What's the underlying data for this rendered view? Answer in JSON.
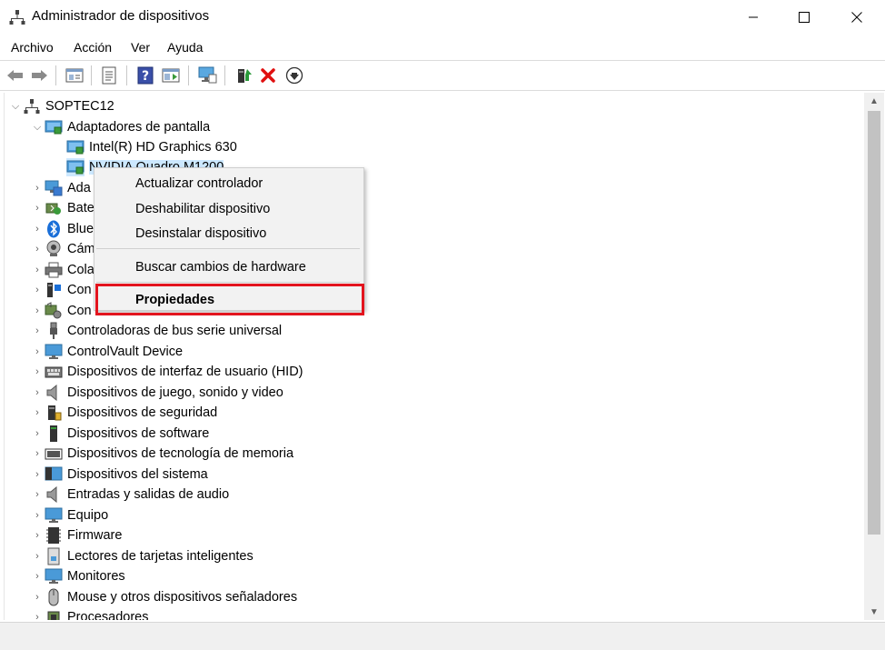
{
  "window": {
    "title": "Administrador de dispositivos",
    "controls": [
      "minimize",
      "maximize",
      "close"
    ]
  },
  "menu": [
    {
      "label": "Archivo"
    },
    {
      "label": "Acción"
    },
    {
      "label": "Ver"
    },
    {
      "label": "Ayuda"
    }
  ],
  "toolbar": [
    "back-icon",
    "forward-icon",
    "properties-view-icon",
    "properties-icon",
    "help-icon",
    "run-view-icon",
    "monitor-icon",
    "update-driver-icon",
    "uninstall-icon",
    "download-icon"
  ],
  "tree": {
    "root": "SOPTEC12",
    "expanded_category": "Adaptadores de pantalla",
    "children": [
      "Intel(R) HD Graphics 630",
      "NVIDIA Quadro M1200"
    ],
    "selected": "NVIDIA Quadro M1200",
    "partial_categories": [
      "Ada",
      "Bate",
      "Blue",
      "Cám",
      "Cola",
      "Con",
      "Con"
    ],
    "categories": [
      "Controladoras de bus serie universal",
      "ControlVault Device",
      "Dispositivos de interfaz de usuario (HID)",
      "Dispositivos de juego, sonido y video",
      "Dispositivos de seguridad",
      "Dispositivos de software",
      "Dispositivos de tecnología de memoria",
      "Dispositivos del sistema",
      "Entradas y salidas de audio",
      "Equipo",
      "Firmware",
      "Lectores de tarjetas inteligentes",
      "Monitores",
      "Mouse y otros dispositivos señaladores",
      "Procesadores"
    ]
  },
  "context_menu": {
    "items": [
      "Actualizar controlador",
      "Deshabilitar dispositivo",
      "Desinstalar dispositivo",
      "Buscar cambios de hardware",
      "Propiedades"
    ],
    "highlighted": "Propiedades",
    "highlight_color": "#e3141e"
  },
  "colors": {
    "selection": "#cce8ff",
    "accent_red": "#e3141e"
  }
}
